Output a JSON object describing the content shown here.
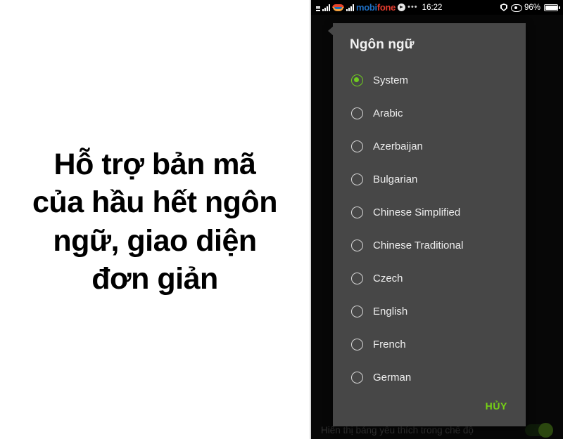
{
  "promo": {
    "lines": [
      "Hỗ trợ bản mã",
      "của hầu hết ngôn",
      "ngữ, giao diện",
      "đơn giản"
    ]
  },
  "phone": {
    "statusbar": {
      "carrier": "mobifone",
      "carrier_part_1": "mobi",
      "carrier_part_2": "fone",
      "dots": "•••",
      "time": "16:22",
      "battery_percent": "96%",
      "icons": {
        "signal": "signal-bars-icon",
        "carrier_logo": "mobifone-logo-icon",
        "globe": "globe-icon",
        "more": "more-dots-icon",
        "shield": "shield-icon",
        "eye": "eye-icon",
        "battery": "battery-icon"
      }
    },
    "background": {
      "setting_label": "Hiển thị bảng yêu thích trong chế độ",
      "toggle_state": "on"
    },
    "dialog": {
      "title": "Ngôn ngữ",
      "selected_value": "System",
      "options": [
        {
          "label": "System",
          "selected": true
        },
        {
          "label": "Arabic",
          "selected": false
        },
        {
          "label": "Azerbaijan",
          "selected": false
        },
        {
          "label": "Bulgarian",
          "selected": false
        },
        {
          "label": "Chinese Simplified",
          "selected": false
        },
        {
          "label": "Chinese Traditional",
          "selected": false
        },
        {
          "label": "Czech",
          "selected": false
        },
        {
          "label": "English",
          "selected": false
        },
        {
          "label": "French",
          "selected": false
        },
        {
          "label": "German",
          "selected": false
        }
      ],
      "cancel_label": "HỦY"
    }
  },
  "colors": {
    "accent_green": "#76d215",
    "radio_green": "#6fcc1f",
    "dialog_bg": "#474747",
    "phone_bg": "#0b0b0b",
    "carrier_blue": "#1f6fc4",
    "carrier_red": "#e23b2e"
  }
}
